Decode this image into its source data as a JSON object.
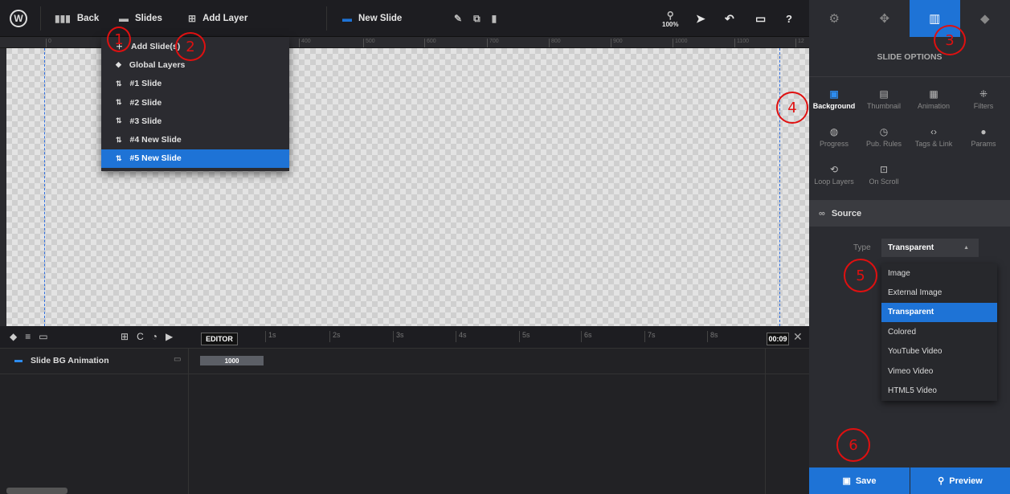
{
  "topbar": {
    "back_label": "Back",
    "slides_label": "Slides",
    "add_layer_label": "Add Layer",
    "slide_name": "New Slide",
    "zoom": "100%"
  },
  "ruler": {
    "ticks": [
      "0",
      "400",
      "500",
      "600",
      "700",
      "800",
      "900",
      "1000",
      "1100",
      "12"
    ]
  },
  "slides_menu": {
    "items": [
      {
        "label": "Add Slide(s)"
      },
      {
        "label": "Global Layers"
      },
      {
        "label": "#1 Slide"
      },
      {
        "label": "#2 Slide"
      },
      {
        "label": "#3 Slide"
      },
      {
        "label": "#4 New Slide"
      },
      {
        "label": "#5 New Slide"
      }
    ]
  },
  "timeline": {
    "editor_label": "EDITOR",
    "ticks": [
      "1s",
      "2s",
      "3s",
      "4s",
      "5s",
      "6s",
      "7s",
      "8s"
    ],
    "time": "00:09",
    "row_label": "Slide BG Animation",
    "duration": "1000"
  },
  "sidebar": {
    "title": "SLIDE OPTIONS",
    "options": [
      {
        "label": "Background",
        "icon": "image-icon"
      },
      {
        "label": "Thumbnail",
        "icon": "thumbnail-icon"
      },
      {
        "label": "Animation",
        "icon": "clapper-icon"
      },
      {
        "label": "Filters",
        "icon": "filters-icon"
      },
      {
        "label": "Progress",
        "icon": "stopwatch-icon"
      },
      {
        "label": "Pub. Rules",
        "icon": "clock-icon"
      },
      {
        "label": "Tags & Link",
        "icon": "code-icon"
      },
      {
        "label": "Params",
        "icon": "info-icon"
      },
      {
        "label": "Loop Layers",
        "icon": "loop-icon"
      },
      {
        "label": "On Scroll",
        "icon": "scroll-icon"
      }
    ],
    "source_label": "Source",
    "type_label": "Type",
    "type_value": "Transparent",
    "type_options": [
      "Image",
      "External Image",
      "Transparent",
      "Colored",
      "YouTube Video",
      "Vimeo Video",
      "HTML5 Video"
    ],
    "save_label": "Save",
    "preview_label": "Preview"
  },
  "annotations": [
    "1",
    "2",
    "3",
    "4",
    "5",
    "6"
  ],
  "colors": {
    "accent": "#1e73d6",
    "annotation": "#e01010"
  }
}
